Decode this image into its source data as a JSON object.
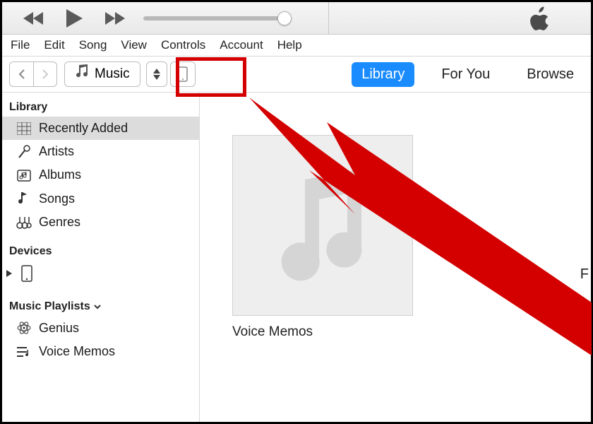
{
  "menubar": [
    "File",
    "Edit",
    "Song",
    "View",
    "Controls",
    "Account",
    "Help"
  ],
  "picker": {
    "label": "Music"
  },
  "tabs": {
    "library": "Library",
    "for_you": "For You",
    "browse": "Browse"
  },
  "sidebar": {
    "library_heading": "Library",
    "library_items": [
      "Recently Added",
      "Artists",
      "Albums",
      "Songs",
      "Genres"
    ],
    "devices_heading": "Devices",
    "playlists_heading": "Music Playlists",
    "playlist_items": [
      "Genius",
      "Voice Memos"
    ]
  },
  "content": {
    "album_title": "Voice Memos"
  },
  "right_cut_letter": "F"
}
